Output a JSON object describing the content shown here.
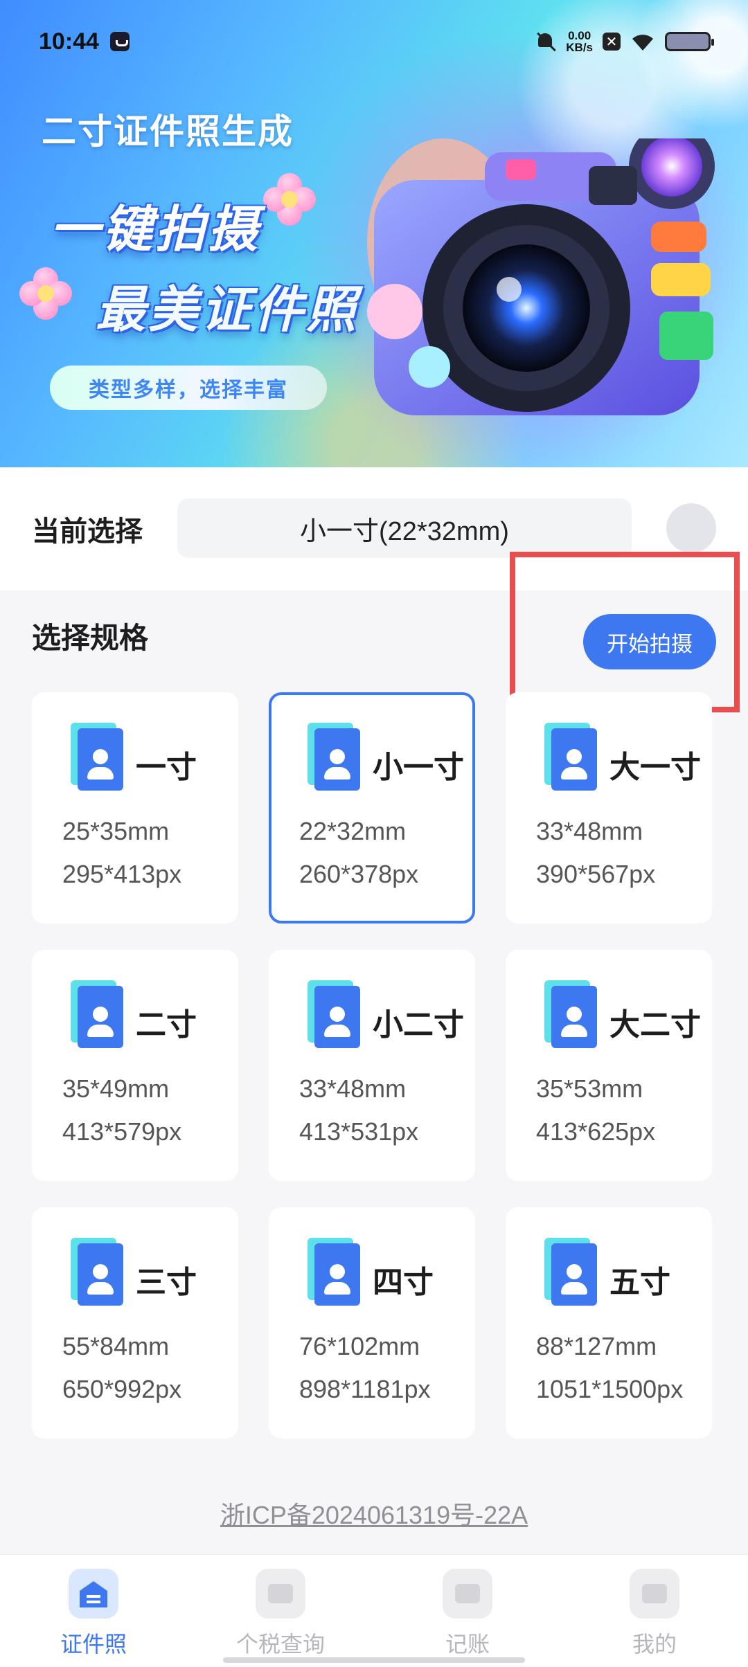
{
  "status_bar": {
    "time": "10:44",
    "net_speed_value": "0.00",
    "net_speed_unit": "KB/s",
    "x_badge": "✕"
  },
  "banner": {
    "title": "二寸证件照生成",
    "slogan_line1": "一键拍摄",
    "slogan_line2": "最美证件照",
    "pill_text": "类型多样，选择丰富"
  },
  "current_selection": {
    "label": "当前选择",
    "value": "小一寸(22*32mm)"
  },
  "spec_section": {
    "title": "选择规格",
    "start_button_label": "开始拍摄"
  },
  "specs": [
    {
      "name": "一寸",
      "mm": "25*35mm",
      "px": "295*413px",
      "selected": false
    },
    {
      "name": "小一寸",
      "mm": "22*32mm",
      "px": "260*378px",
      "selected": true
    },
    {
      "name": "大一寸",
      "mm": "33*48mm",
      "px": "390*567px",
      "selected": false
    },
    {
      "name": "二寸",
      "mm": "35*49mm",
      "px": "413*579px",
      "selected": false
    },
    {
      "name": "小二寸",
      "mm": "33*48mm",
      "px": "413*531px",
      "selected": false
    },
    {
      "name": "大二寸",
      "mm": "35*53mm",
      "px": "413*625px",
      "selected": false
    },
    {
      "name": "三寸",
      "mm": "55*84mm",
      "px": "650*992px",
      "selected": false
    },
    {
      "name": "四寸",
      "mm": "76*102mm",
      "px": "898*1181px",
      "selected": false
    },
    {
      "name": "五寸",
      "mm": "88*127mm",
      "px": "1051*1500px",
      "selected": false
    }
  ],
  "footer": {
    "icp": "浙ICP备2024061319号-22A"
  },
  "bottom_nav": [
    {
      "label": "证件照",
      "icon": "id-photo-icon",
      "active": true
    },
    {
      "label": "个税查询",
      "icon": "wallet-icon",
      "active": false
    },
    {
      "label": "记账",
      "icon": "bookkeeping-icon",
      "active": false
    },
    {
      "label": "我的",
      "icon": "profile-icon",
      "active": false
    }
  ],
  "colors": {
    "accent": "#3d78f0",
    "highlight": "#ea4d4d",
    "icon_teal": "#5ee0ea"
  }
}
